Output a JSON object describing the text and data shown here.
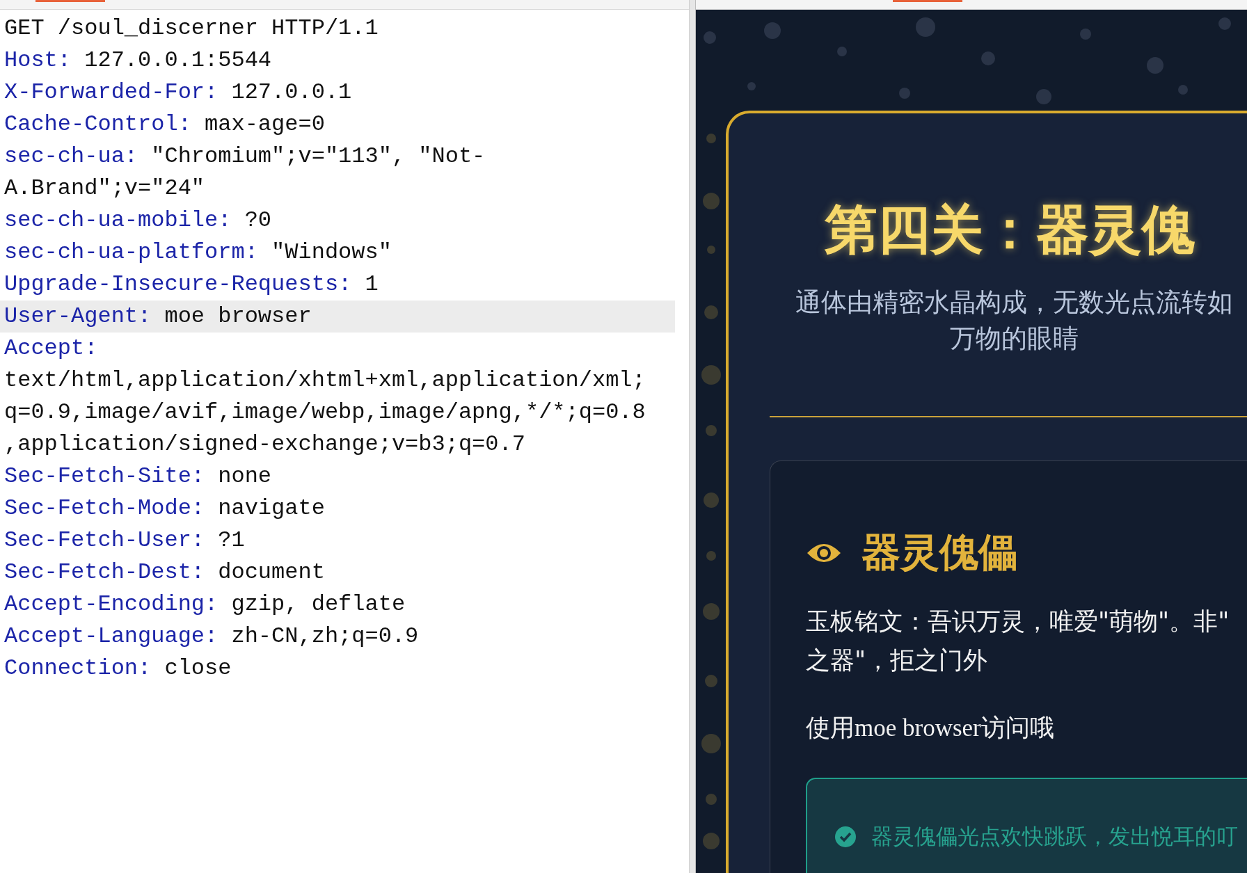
{
  "request": {
    "request_line": "GET /soul_discerner HTTP/1.1",
    "headers": [
      {
        "name": "Host:",
        "value": "127.0.0.1:5544",
        "selected": false
      },
      {
        "name": "X-Forwarded-For:",
        "value": "127.0.0.1",
        "selected": false
      },
      {
        "name": "Cache-Control:",
        "value": "max-age=0",
        "selected": false
      },
      {
        "name": "sec-ch-ua:",
        "value": "\"Chromium\";v=\"113\", \"Not-A.Brand\";v=\"24\"",
        "selected": false
      },
      {
        "name": "sec-ch-ua-mobile:",
        "value": "?0",
        "selected": false
      },
      {
        "name": "sec-ch-ua-platform:",
        "value": "\"Windows\"",
        "selected": false
      },
      {
        "name": "Upgrade-Insecure-Requests:",
        "value": "1",
        "selected": false
      },
      {
        "name": "User-Agent:",
        "value": "moe browser",
        "selected": true
      },
      {
        "name": "Accept:",
        "value": "text/html,application/xhtml+xml,application/xml;q=0.9,image/avif,image/webp,image/apng,*/*;q=0.8,application/signed-exchange;v=b3;q=0.7",
        "selected": false
      },
      {
        "name": "Sec-Fetch-Site:",
        "value": "none",
        "selected": false
      },
      {
        "name": "Sec-Fetch-Mode:",
        "value": "navigate",
        "selected": false
      },
      {
        "name": "Sec-Fetch-User:",
        "value": "?1",
        "selected": false
      },
      {
        "name": "Sec-Fetch-Dest:",
        "value": "document",
        "selected": false
      },
      {
        "name": "Accept-Encoding:",
        "value": "gzip, deflate",
        "selected": false
      },
      {
        "name": "Accept-Language:",
        "value": "zh-CN,zh;q=0.9",
        "selected": false
      },
      {
        "name": "Connection:",
        "value": "close",
        "selected": false
      }
    ]
  },
  "preview": {
    "title": "第四关：器灵傀",
    "subtitle_lines": [
      "通体由精密水晶构成，无数光点流转如",
      "万物的眼睛"
    ],
    "section": {
      "heading": "器灵傀儡",
      "inscription_lines": [
        "玉板铭文：吾识万灵，唯爱\"萌物\"。非\"",
        "之器\"，拒之门外"
      ],
      "hint": "使用moe browser访问哦",
      "success": "器灵傀儡光点欢快跳跃，发出悦耳的叮"
    }
  }
}
